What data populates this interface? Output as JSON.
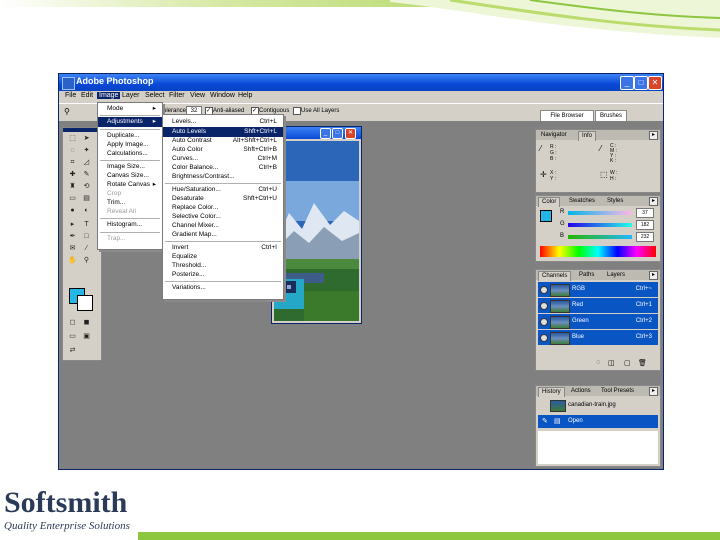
{
  "app": {
    "title": "Adobe Photoshop",
    "window_buttons": {
      "minimize": "_",
      "maximize": "□",
      "close": "✕"
    }
  },
  "menubar": [
    "File",
    "Edit",
    "Image",
    "Layer",
    "Select",
    "Filter",
    "View",
    "Window",
    "Help"
  ],
  "options_bar": {
    "tolerance_label": "Tolerance:",
    "tolerance_value": "32",
    "anti_aliased_label": "Anti-aliased",
    "contiguous_label": "Contiguous",
    "use_all_layers_label": "Use All Layers"
  },
  "palette_well": {
    "tabs": [
      "File Browser",
      "Brushes"
    ]
  },
  "image_menu": [
    {
      "label": "Mode",
      "submenu": true
    },
    {
      "label": "Adjustments",
      "submenu": true,
      "highlighted": true
    },
    {
      "label": "Duplicate..."
    },
    {
      "label": "Apply Image..."
    },
    {
      "label": "Calculations..."
    },
    {
      "label": "Image Size..."
    },
    {
      "label": "Canvas Size..."
    },
    {
      "label": "Rotate Canvas",
      "submenu": true
    },
    {
      "label": "Crop",
      "disabled": true
    },
    {
      "label": "Trim..."
    },
    {
      "label": "Reveal All",
      "disabled": true
    },
    {
      "label": "Histogram..."
    },
    {
      "label": "Trap...",
      "disabled": true
    }
  ],
  "adjustments_menu": [
    {
      "label": "Levels...",
      "shortcut": "Ctrl+L"
    },
    {
      "label": "Auto Levels",
      "shortcut": "Shft+Ctrl+L",
      "highlighted": true
    },
    {
      "label": "Auto Contrast",
      "shortcut": "Alt+Shft+Ctrl+L"
    },
    {
      "label": "Auto Color",
      "shortcut": "Shft+Ctrl+B"
    },
    {
      "label": "Curves...",
      "shortcut": "Ctrl+M"
    },
    {
      "label": "Color Balance...",
      "shortcut": "Ctrl+B"
    },
    {
      "label": "Brightness/Contrast..."
    },
    {
      "label": "Hue/Saturation...",
      "shortcut": "Ctrl+U"
    },
    {
      "label": "Desaturate",
      "shortcut": "Shft+Ctrl+U"
    },
    {
      "label": "Replace Color..."
    },
    {
      "label": "Selective Color..."
    },
    {
      "label": "Channel Mixer..."
    },
    {
      "label": "Gradient Map..."
    },
    {
      "label": "Invert",
      "shortcut": "Ctrl+I"
    },
    {
      "label": "Equalize"
    },
    {
      "label": "Threshold..."
    },
    {
      "label": "Posterize..."
    },
    {
      "label": "Variations..."
    }
  ],
  "navigator_panel": {
    "tabs": [
      "Navigator",
      "Info"
    ],
    "labels": [
      "R :",
      "G :",
      "B :",
      "C :",
      "M :",
      "Y :",
      "K :",
      "X :",
      "Y :",
      "W :",
      "H :"
    ]
  },
  "color_panel": {
    "tabs": [
      "Color",
      "Swatches",
      "Styles"
    ],
    "sliders": [
      {
        "label": "R",
        "value": "37"
      },
      {
        "label": "G",
        "value": "182"
      },
      {
        "label": "B",
        "value": "232"
      }
    ]
  },
  "channels_panel": {
    "tabs": [
      "Channels",
      "Paths",
      "Layers"
    ],
    "rows": [
      {
        "name": "RGB",
        "shortcut": "Ctrl+~"
      },
      {
        "name": "Red",
        "shortcut": "Ctrl+1"
      },
      {
        "name": "Green",
        "shortcut": "Ctrl+2"
      },
      {
        "name": "Blue",
        "shortcut": "Ctrl+3"
      }
    ]
  },
  "history_panel": {
    "tabs": [
      "History",
      "Actions",
      "Tool Presets"
    ],
    "rows": [
      {
        "name": "canadian-train.jpg"
      },
      {
        "name": "Open"
      }
    ]
  },
  "colors": {
    "fg": "#25b6e8",
    "bg": "#ffffff",
    "selection": "#0a246a",
    "logo": "#2a3a57",
    "accent": "#8dc63f"
  },
  "logo": {
    "name": "Softsmith",
    "tagline": "Quality Enterprise Solutions"
  }
}
